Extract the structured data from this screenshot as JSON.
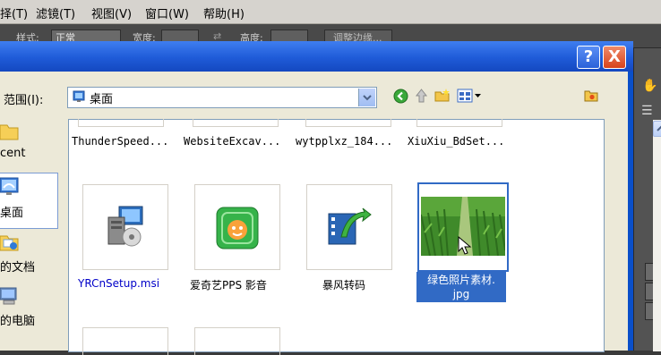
{
  "menubar": {
    "items": [
      "择(T)",
      "滤镜(T)",
      "视图(V)",
      "窗口(W)",
      "帮助(H)"
    ]
  },
  "options_bar": {
    "style_label": "样式:",
    "style_value": "正常",
    "width_label": "宽度:",
    "height_label": "高度:",
    "refine_label": "调整边缘..."
  },
  "dialog": {
    "help_button": "?",
    "close_button": "X",
    "look_in_label": "范围(I):",
    "look_in_value": "桌面"
  },
  "places": [
    {
      "label": "cent",
      "icon": "folder-icon"
    },
    {
      "label": "桌面",
      "icon": "desktop-icon"
    },
    {
      "label": "的文档",
      "icon": "documents-icon"
    },
    {
      "label": "的电脑",
      "icon": "computer-icon"
    }
  ],
  "files_top_row": [
    "ThunderSpeed...",
    "WebsiteExcav...",
    "wytpplxz_184...",
    "XiuXiu_BdSet..."
  ],
  "files": [
    {
      "label": "YRCnSetup.msi",
      "icon": "installer-icon"
    },
    {
      "label": "爱奇艺PPS 影音",
      "icon": "iqiyi-pps-icon"
    },
    {
      "label": "暴风转码",
      "icon": "baofeng-converter-icon"
    },
    {
      "label": "绿色照片素材.jpg",
      "label_line1": "绿色照片素材.",
      "label_line2": "jpg",
      "icon": "image-thumbnail",
      "selected": true
    }
  ],
  "colors": {
    "title_bar": "#1f5bd8",
    "selection": "#316ac5",
    "dialog_body": "#ece9d8"
  }
}
